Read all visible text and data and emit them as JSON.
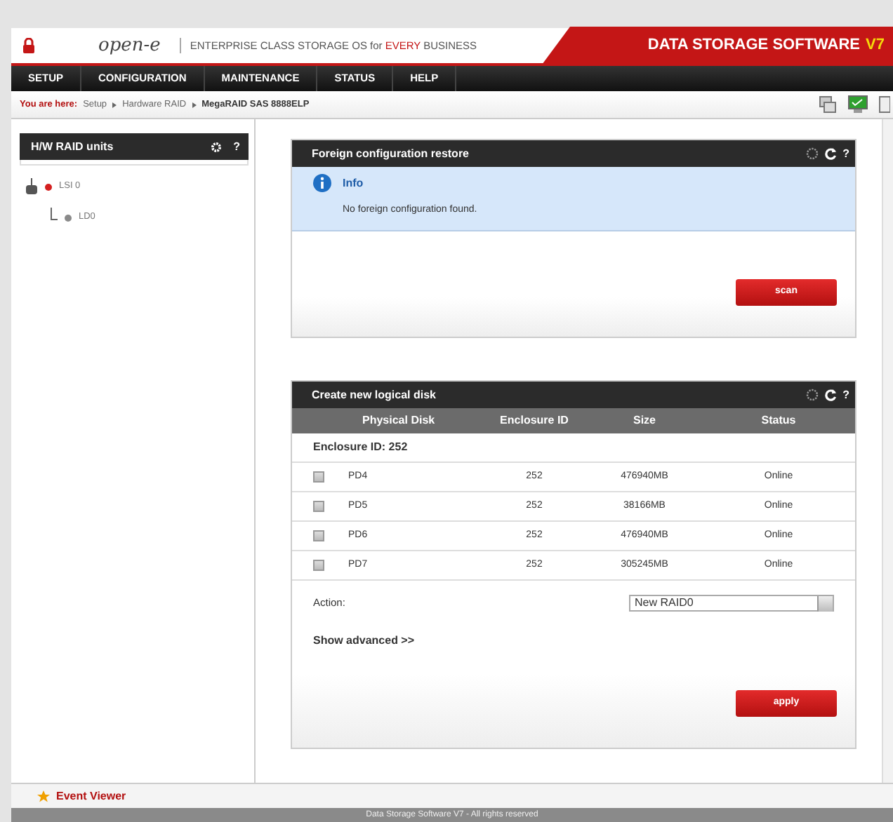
{
  "header": {
    "logo": "open-e",
    "tagline": [
      {
        "text": "ENTERPRISE CLASS STORAGE OS for ",
        "highlight": false
      },
      {
        "text": "EVERY",
        "highlight": true
      },
      {
        "text": " BUSINESS",
        "highlight": false
      }
    ],
    "title": "DATA STORAGE SOFTWARE",
    "version": "V7"
  },
  "menu": [
    {
      "label": "SETUP"
    },
    {
      "label": "CONFIGURATION"
    },
    {
      "label": "MAINTENANCE"
    },
    {
      "label": "STATUS"
    },
    {
      "label": "HELP"
    }
  ],
  "breadcrumb": {
    "label": "You are here:",
    "items": [
      {
        "text": "Setup",
        "current": false
      },
      {
        "text": "Hardware RAID",
        "current": false
      },
      {
        "text": "MegaRAID SAS 8888ELP",
        "current": true
      }
    ]
  },
  "sidebar": {
    "title": "H/W RAID units",
    "tree": [
      {
        "label": "LSI 0",
        "color": "#d42020",
        "children": [
          {
            "label": "LD0",
            "color": "#8a8a8a"
          }
        ]
      }
    ],
    "help": "?"
  },
  "foreign_panel": {
    "title": "Foreign configuration restore",
    "help": "?",
    "info_title": "Info",
    "info_text": "No foreign configuration found.",
    "button": "scan"
  },
  "create_panel": {
    "title": "Create new logical disk",
    "help": "?",
    "columns": [
      "Physical Disk",
      "Enclosure ID",
      "Size",
      "Status"
    ],
    "group": "Enclosure ID: 252",
    "rows": [
      {
        "disk": "PD4",
        "enclosure": "252",
        "size": "476940MB",
        "status": "Online",
        "checked": false
      },
      {
        "disk": "PD5",
        "enclosure": "252",
        "size": "38166MB",
        "status": "Online",
        "checked": false
      },
      {
        "disk": "PD6",
        "enclosure": "252",
        "size": "476940MB",
        "status": "Online",
        "checked": false
      },
      {
        "disk": "PD7",
        "enclosure": "252",
        "size": "305245MB",
        "status": "Online",
        "checked": false
      }
    ],
    "action_label": "Action:",
    "action_value": "New RAID0",
    "advanced": "Show advanced >>",
    "button": "apply"
  },
  "event_viewer": "Event Viewer",
  "footer": "Data Storage Software V7 - All rights reserved"
}
